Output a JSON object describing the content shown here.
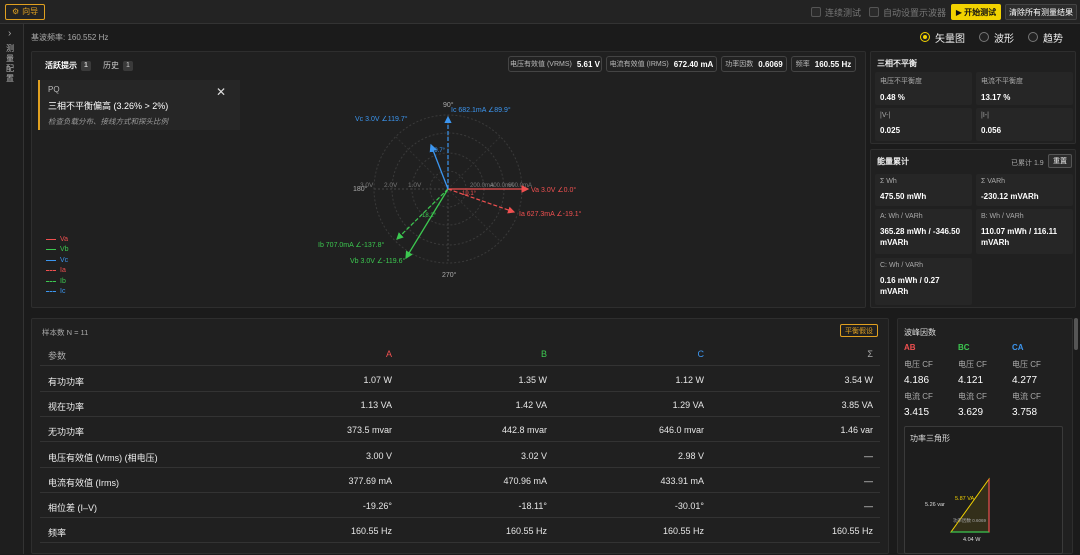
{
  "topbar": {
    "wizard_label": "向导",
    "continuous_test": "连续测试",
    "auto_scope": "自动设置示波器",
    "start_label": "开始测试",
    "clear_label": "清除所有测量结果"
  },
  "leftrail": {
    "label": "测量配置"
  },
  "base_frequency": "基波频率: 160.552 Hz",
  "views": {
    "vector": "矢量图",
    "waveform": "波形",
    "trend": "趋势",
    "selected": "vector"
  },
  "tabs": {
    "active": {
      "label": "活跃提示",
      "count": "1"
    },
    "history": {
      "label": "历史",
      "count": "1"
    }
  },
  "alert": {
    "category": "PQ",
    "title": "三相不平衡偏高 (3.26% > 2%)",
    "hint": "检查负载分布、接线方式和探头比例"
  },
  "pills": [
    {
      "label": "电压有效值 (VRMS)",
      "value": "5.61 V"
    },
    {
      "label": "电流有效值 (IRMS)",
      "value": "672.40 mA"
    },
    {
      "label": "功率因数",
      "value": "0.6069"
    },
    {
      "label": "频率",
      "value": "160.55 Hz"
    }
  ],
  "legend": [
    {
      "name": "Va",
      "color": "#f05050",
      "dashed": false
    },
    {
      "name": "Vb",
      "color": "#3cc850",
      "dashed": false
    },
    {
      "name": "Vc",
      "color": "#3c96f0",
      "dashed": false
    },
    {
      "name": "Ia",
      "color": "#f05050",
      "dashed": true
    },
    {
      "name": "Ib",
      "color": "#3cc850",
      "dashed": true
    },
    {
      "name": "Ic",
      "color": "#3c96f0",
      "dashed": true
    }
  ],
  "vector": {
    "angle_labels": {
      "a90": "90°",
      "a180": "180°",
      "a270": "270°"
    },
    "ring_labels": {
      "r1": "3.0V",
      "r2": "2.0V",
      "r3": "1.0V",
      "ri1": "200.0mA",
      "ri2": "400.0mA",
      "ri3": "600.0mA"
    },
    "vc_label": "Vc 3.0V ∠119.7°",
    "ic_label": "Ic 682.1mA ∠89.9°",
    "va_label": "Va 3.0V ∠0.0°",
    "ia_label": "Ia 627.3mA ∠-19.1°",
    "ib_label": "Ib 707.0mA ∠-137.8°",
    "vb_label": "Vb 3.0V ∠-119.6°",
    "arc1": "29.7°",
    "arc2": "19.1°",
    "arc3": "18.2°"
  },
  "imbalance": {
    "title": "三相不平衡",
    "cells": [
      {
        "label": "电压不平衡度",
        "value": "0.48 %"
      },
      {
        "label": "电流不平衡度",
        "value": "13.17 %"
      },
      {
        "label": "|V-|",
        "value": "0.025"
      },
      {
        "label": "|I-|",
        "value": "0.056"
      }
    ]
  },
  "energy": {
    "title": "能量累计",
    "accumulated": "已累计 1.9",
    "reset_label": "重置",
    "cells": [
      {
        "label": "Σ Wh",
        "value": "475.50 mWh"
      },
      {
        "label": "Σ VARh",
        "value": "-230.12 mVARh"
      },
      {
        "label": "A: Wh / VARh",
        "value": "365.28 mWh / -346.50 mVARh"
      },
      {
        "label": "B: Wh / VARh",
        "value": "110.07 mWh / 116.11 mVARh"
      },
      {
        "label": "C: Wh / VARh",
        "value": "0.16 mWh / 0.27 mVARh"
      }
    ]
  },
  "table": {
    "samples": "样本数 N = 11",
    "balance_label": "平衡假设",
    "headers": [
      "参数",
      "A",
      "B",
      "C",
      "Σ"
    ],
    "rows": [
      [
        "有功功率",
        "1.07 W",
        "1.35 W",
        "1.12 W",
        "3.54 W"
      ],
      [
        "视在功率",
        "1.13 VA",
        "1.42 VA",
        "1.29 VA",
        "3.85 VA"
      ],
      [
        "无功功率",
        "373.5 mvar",
        "442.8 mvar",
        "646.0 mvar",
        "1.46 var"
      ],
      [
        "电压有效值 (Vrms) (相电压)",
        "3.00 V",
        "3.02 V",
        "2.98 V",
        "—"
      ],
      [
        "电流有效值 (Irms)",
        "377.69 mA",
        "470.96 mA",
        "433.91 mA",
        "—"
      ],
      [
        "相位差 (I–V)",
        "-19.26°",
        "-18.11°",
        "-30.01°",
        "—"
      ],
      [
        "频率",
        "160.55 Hz",
        "160.55 Hz",
        "160.55 Hz",
        "160.55 Hz"
      ]
    ]
  },
  "crest": {
    "title": "波峰因数",
    "groups": [
      {
        "name": "AB",
        "color": "#f05050",
        "vlabel": "电压 CF",
        "v": "4.186",
        "ilabel": "电流 CF",
        "i": "3.415"
      },
      {
        "name": "BC",
        "color": "#3cc850",
        "vlabel": "电压 CF",
        "v": "4.121",
        "ilabel": "电流 CF",
        "i": "3.629"
      },
      {
        "name": "CA",
        "color": "#3c96f0",
        "vlabel": "电压 CF",
        "v": "4.277",
        "ilabel": "电流 CF",
        "i": "3.758"
      }
    ]
  },
  "power_triangle": {
    "title": "功率三角形",
    "s_label": "5.87 VA",
    "q_label": "5.26 var",
    "p_label": "4.04 W",
    "pf_label": "功率因数 0.6069"
  }
}
